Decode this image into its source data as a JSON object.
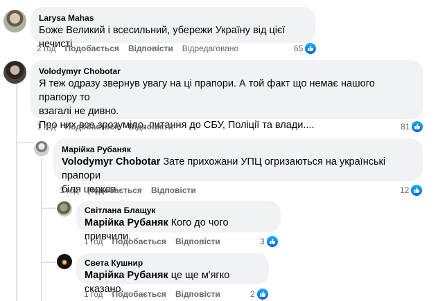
{
  "actions": {
    "like": "Подобається",
    "reply": "Відповісти",
    "edited": "Відредаговано"
  },
  "comments": [
    {
      "author": "Larysa Mahas",
      "text": "Боже Великий і всесильний, убережи Україну від цієї нечисті",
      "time": "2 год",
      "reactions": "65"
    },
    {
      "author": "Volodymyr Chobotar",
      "text_line1": "Я теж одразу звернув увагу на ці прапори. А той факт що немає нашого прапору то",
      "text_line2": "взагалі не дивно.",
      "text_line3": "Про них все зрозуміло, питання до СБУ, Поліції та влади....",
      "time": "1 год",
      "reactions": "81"
    },
    {
      "author": "Марійка Рубаняк",
      "mention": "Volodymyr Chobotar",
      "text_line1": "Зате прихожани УПЦ огризаються на українські прапори",
      "text_line2": "біля церков",
      "time": "1 год",
      "reactions": "12"
    },
    {
      "author": "Світлана Блащук",
      "mention": "Марійка Рубаняк",
      "text": "Кого до чого привчили.",
      "time": "1 год",
      "reactions": "3"
    },
    {
      "author": "Света Кушнир",
      "mention": "Марійка Рубаняк",
      "text": "це ще м'ягко сказано.",
      "time": "1 год",
      "reactions": "2"
    }
  ],
  "colors": {
    "bubble": "#f0f2f5",
    "meta": "#65676b",
    "like_blue": "#1877f2"
  },
  "icons": {
    "like": "thumbs-up-icon"
  }
}
